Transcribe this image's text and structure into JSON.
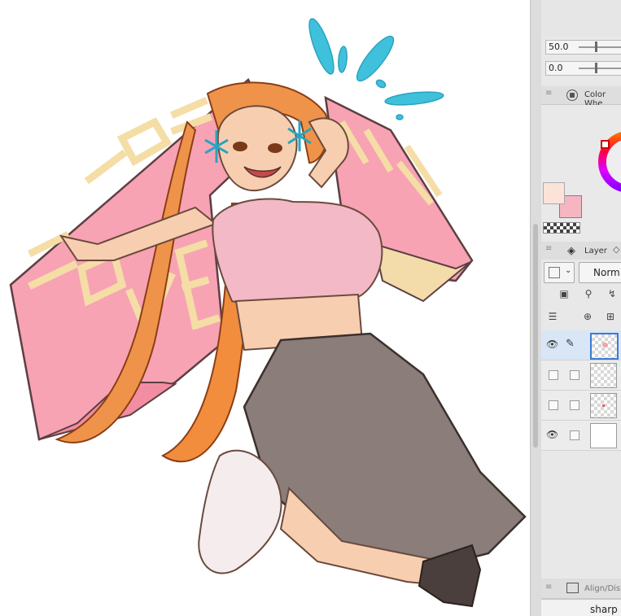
{
  "sliders": [
    {
      "value": "50.0",
      "level": 0.5
    },
    {
      "value": "0.0",
      "level": 0.5
    }
  ],
  "color_wheel_panel": {
    "title": "Color Whe",
    "main_color": "#fbe3da",
    "sub_color": "#f5b6c2"
  },
  "layer_panel": {
    "tab_label": "Layer",
    "blend_mode": "Norm",
    "layers": [
      {
        "visible": true,
        "editing": true,
        "selected": true,
        "thumb": "transparent"
      },
      {
        "visible": false,
        "editing": false,
        "selected": false,
        "thumb": "transparent"
      },
      {
        "visible": false,
        "editing": false,
        "selected": false,
        "thumb": "transparent"
      },
      {
        "visible": true,
        "editing": false,
        "selected": false,
        "thumb": "white"
      }
    ]
  },
  "bottom_panel": {
    "title": "Align/Dist",
    "field_value": "sharp"
  },
  "colors": {
    "hair": "#f0934a",
    "banner_pink": "#f7a3b4",
    "banner_text": "#f5dda6",
    "shirt": "#f3b9c6",
    "skirt": "#8a7d7a",
    "sparkle": "#3fc1dc",
    "skin": "#f7cfb0"
  }
}
